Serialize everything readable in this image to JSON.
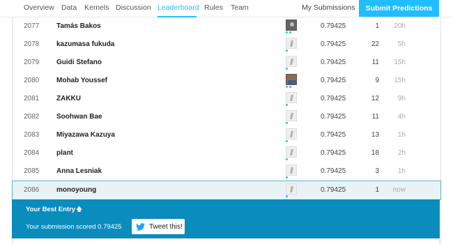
{
  "nav": {
    "tabs": [
      "Overview",
      "Data",
      "Kernels",
      "Discussion",
      "Leaderboard",
      "Rules",
      "Team"
    ],
    "active_tab": "Leaderboard",
    "my_submissions": "My Submissions",
    "submit_label": "Submit Predictions"
  },
  "rows": [
    {
      "rank": "2077",
      "name": "Tamás Bakos",
      "score": "0.79425",
      "entries": "1",
      "last": "20h",
      "avatar": "photo"
    },
    {
      "rank": "2078",
      "name": "kazumasa fukuda",
      "score": "0.79425",
      "entries": "22",
      "last": "5h",
      "avatar": "default"
    },
    {
      "rank": "2079",
      "name": "Guidi Stefano",
      "score": "0.79425",
      "entries": "11",
      "last": "15h",
      "avatar": "default"
    },
    {
      "rank": "2080",
      "name": "Mohab Youssef",
      "score": "0.79425",
      "entries": "9",
      "last": "15h",
      "avatar": "photo2"
    },
    {
      "rank": "2081",
      "name": "ZAKKU",
      "score": "0.79425",
      "entries": "12",
      "last": "9h",
      "avatar": "default"
    },
    {
      "rank": "2082",
      "name": "Soohwan Bae",
      "score": "0.79425",
      "entries": "11",
      "last": "4h",
      "avatar": "default"
    },
    {
      "rank": "2083",
      "name": "Miyazawa Kazuya",
      "score": "0.79425",
      "entries": "13",
      "last": "1h",
      "avatar": "default"
    },
    {
      "rank": "2084",
      "name": "plant",
      "score": "0.79425",
      "entries": "18",
      "last": "2h",
      "avatar": "default"
    },
    {
      "rank": "2085",
      "name": "Anna Lesniak",
      "score": "0.79425",
      "entries": "3",
      "last": "1h",
      "avatar": "default"
    },
    {
      "rank": "2086",
      "name": "monoyoung",
      "score": "0.79425",
      "entries": "1",
      "last": "now",
      "avatar": "default"
    }
  ],
  "best_entry": {
    "title": "Your Best Entry",
    "arrow": "🡅",
    "scored_text": "Your submission scored 0.79425",
    "tweet_label": "Tweet this!"
  },
  "colors": {
    "accent": "#20beff",
    "panel": "#0a8cbd",
    "highlight_row": "#e8f3f7"
  }
}
